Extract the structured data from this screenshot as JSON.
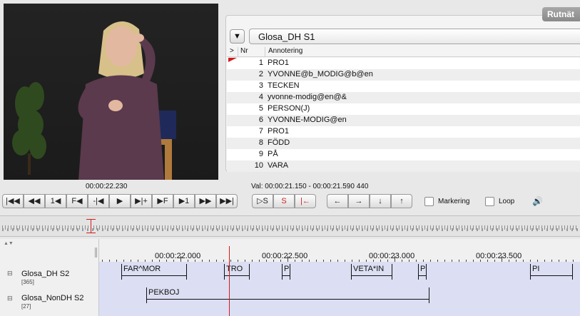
{
  "video": {
    "current_time": "00:00:22.230"
  },
  "selection": {
    "text": "Val: 00:00:21.150 - 00:00:21.590  440"
  },
  "annotation_panel": {
    "tab_label": "Rutnät",
    "tier": "Glosa_DH S1",
    "columns": [
      ">",
      "Nr",
      "Annotering"
    ],
    "rows": [
      {
        "nr": "1",
        "annotation": "PRO1"
      },
      {
        "nr": "2",
        "annotation": "YVONNE@b_MODIG@b@en"
      },
      {
        "nr": "3",
        "annotation": "TECKEN"
      },
      {
        "nr": "4",
        "annotation": "yvonne-modig@en@&"
      },
      {
        "nr": "5",
        "annotation": "PERSON(J)"
      },
      {
        "nr": "6",
        "annotation": "YVONNE-MODIG@en"
      },
      {
        "nr": "7",
        "annotation": "PRO1"
      },
      {
        "nr": "8",
        "annotation": "FÖDD"
      },
      {
        "nr": "9",
        "annotation": "PÅ"
      },
      {
        "nr": "10",
        "annotation": "VARA"
      }
    ]
  },
  "transport": {
    "buttons": [
      "|◀◀",
      "◀◀",
      "1◀",
      "F◀",
      "-|◀",
      "▶",
      "▶|+",
      "▶F",
      "▶1",
      "▶▶",
      "▶▶|"
    ],
    "selection_buttons": [
      "▷S",
      "S",
      "|←"
    ],
    "arrow_buttons": [
      "←",
      "→",
      "↓",
      "↑"
    ],
    "markering_label": "Markering",
    "loop_label": "Loop"
  },
  "timeline": {
    "ruler_labels": [
      "00:00:22.000",
      "00:00:22.500",
      "00:00:23.000",
      "00:00:23.500"
    ],
    "tiers": [
      {
        "name": "Glosa_DH S2",
        "count": "[365]",
        "segments": [
          {
            "label": "FAR^MOR"
          },
          {
            "label": "TRO"
          },
          {
            "label": "P"
          },
          {
            "label": "VETA*IN"
          },
          {
            "label": "P"
          },
          {
            "label": "PI"
          }
        ]
      },
      {
        "name": "Glosa_NonDH S2",
        "count": "[27]",
        "segments": [
          {
            "label": "PEKBOJ"
          }
        ]
      }
    ]
  }
}
